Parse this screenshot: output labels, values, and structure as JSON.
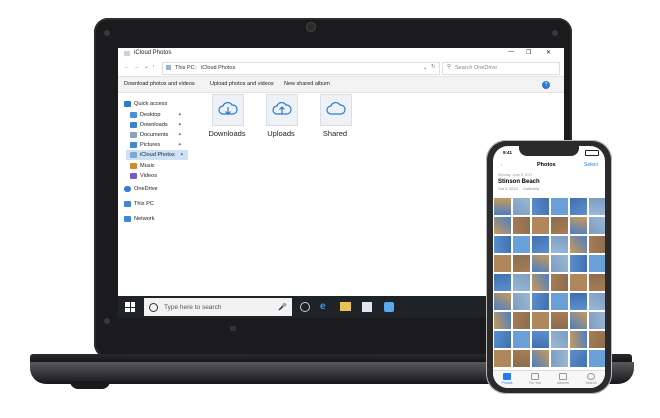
{
  "explorer": {
    "title": "iCloud Photos",
    "breadcrumb": [
      "This PC",
      "iCloud Photos"
    ],
    "search_placeholder": "Search OneDrive",
    "ribbon": [
      "Download photos and videos",
      "Upload photos and videos",
      "New shared album"
    ],
    "nav": [
      {
        "label": "Quick access",
        "color": "#2b7bd1",
        "pinned": false
      },
      {
        "label": "Desktop",
        "color": "#4a90d9",
        "pinned": true
      },
      {
        "label": "Downloads",
        "color": "#3a83d3",
        "pinned": true
      },
      {
        "label": "Documents",
        "color": "#8aa2bb",
        "pinned": true
      },
      {
        "label": "Pictures",
        "color": "#3d8ad6",
        "pinned": true
      },
      {
        "label": "iCloud Photos",
        "color": "#7ea8d6",
        "pinned": true
      },
      {
        "label": "Music",
        "color": "#d08a2e",
        "pinned": false
      },
      {
        "label": "Videos",
        "color": "#7a5ac8",
        "pinned": false
      },
      {
        "label": "OneDrive",
        "color": "#2f7fd3",
        "pinned": false
      },
      {
        "label": "This PC",
        "color": "#3f86d4",
        "pinned": false
      },
      {
        "label": "Network",
        "color": "#3f86d4",
        "pinned": false
      }
    ],
    "folders": [
      {
        "label": "Downloads",
        "icon": "cloud-download-icon"
      },
      {
        "label": "Uploads",
        "icon": "cloud-upload-icon"
      },
      {
        "label": "Shared",
        "icon": "cloud-icon"
      }
    ],
    "taskbar_search": "Type here to search"
  },
  "phone": {
    "time": "9:41",
    "title": "Photos",
    "select": "Select",
    "date_line": "Monday, June 5, 2017",
    "place": "Stinson Beach",
    "date_sub": "Oct 3, 2013",
    "place_sub": "California",
    "tabs": [
      "Photos",
      "For You",
      "Albums",
      "Search"
    ]
  },
  "colors": {
    "accent": "#2b7bd1",
    "ios_blue": "#1f7cf2"
  }
}
